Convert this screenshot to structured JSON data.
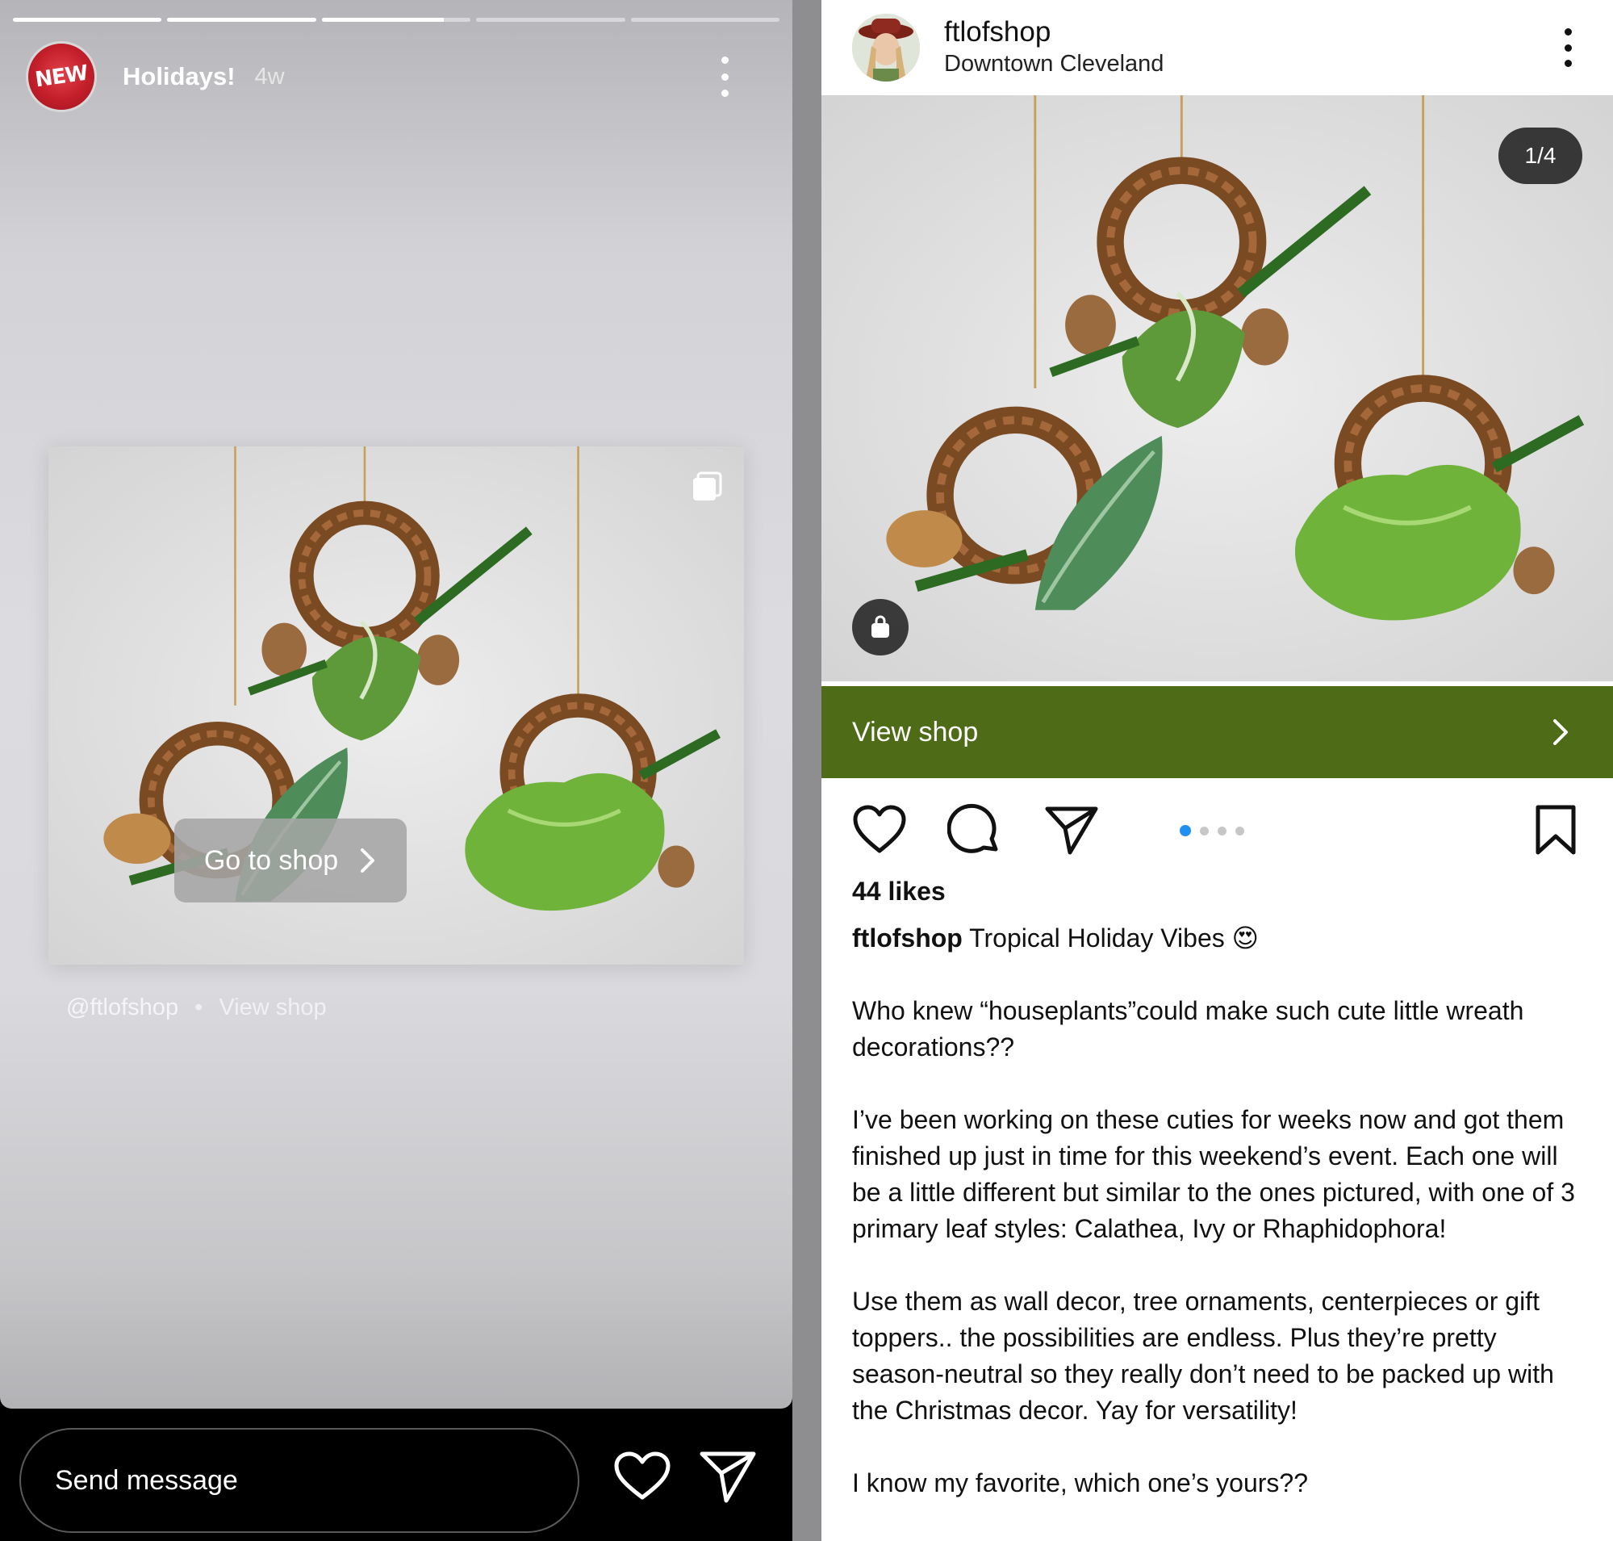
{
  "story": {
    "progress_segments": [
      1,
      1,
      0.82,
      0,
      0
    ],
    "title": "Holidays!",
    "time": "4w",
    "avatar_text": "NEW",
    "go_to_shop": "Go to shop",
    "credit_handle": "@ftlofshop",
    "credit_separator": "•",
    "credit_link": "View shop",
    "reply_placeholder": "Send message"
  },
  "post": {
    "username": "ftlofshop",
    "location": "Downtown Cleveland",
    "image_counter": "1/4",
    "view_shop": "View shop",
    "carousel_total": 4,
    "carousel_active": 0,
    "likes": "44 likes",
    "caption_user": "ftlofshop",
    "caption_title": "Tropical Holiday Vibes",
    "caption_emoji": "😍",
    "paragraphs": [
      "Who knew “houseplants”could make such cute little wreath decorations??",
      "I’ve been working on these cuties for weeks now and got them finished up just in time for this weekend’s event. Each one will be a little different but similar to the ones pictured, with one of 3 primary leaf styles: Calathea, Ivy or Rhaphidophora!",
      "Use them as wall decor, tree ornaments, centerpieces or gift toppers.. the possibilities are endless. Plus they’re pretty season-neutral so they really don’t need to be packed up with the Christmas decor. Yay for versatility!",
      "I know my favorite, which one’s yours??"
    ],
    "accent_color": "#4e6b17",
    "carousel_dot_color": "#1e90f0"
  },
  "icons": {
    "story_more": "more-vertical-icon",
    "multi_image": "multi-image-icon",
    "chevron": "chevron-right-icon",
    "heart": "heart-icon",
    "send": "send-icon",
    "comment": "comment-icon",
    "bookmark": "bookmark-icon",
    "shopping_bag": "shopping-bag-icon"
  }
}
